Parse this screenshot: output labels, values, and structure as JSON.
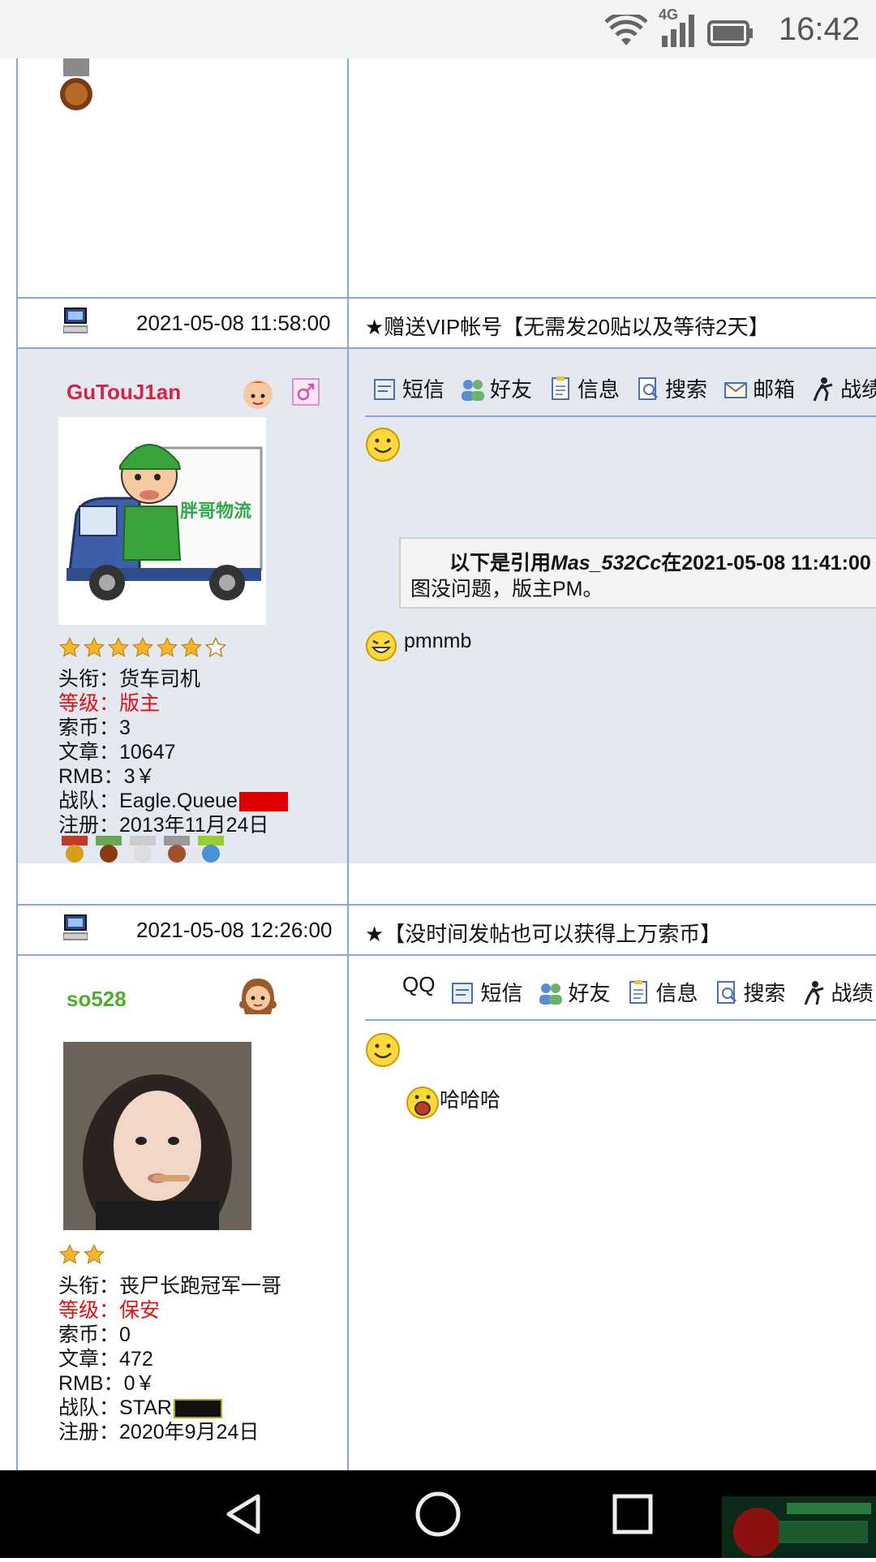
{
  "status_bar": {
    "time": "16:42",
    "network": "4G"
  },
  "post1": {
    "timestamp": "2021-05-08 11:58:00",
    "subject": "★赠送VIP帐号【无需发20贴以及等待2天】",
    "username": "GuTouJ1an",
    "stars": {
      "filled": 6,
      "total": 7
    },
    "info": {
      "title_label": "头衔：",
      "title_value": "货车司机",
      "level_label": "等级：",
      "level_value": "版主",
      "coins_label": "索币：",
      "coins_value": "3",
      "posts_label": "文章：",
      "posts_value": "10647",
      "rmb_label": "RMB：",
      "rmb_value": "3￥",
      "team_label": "战队：",
      "team_value": "Eagle.Queue",
      "reg_label": "注册：",
      "reg_value": "2013年11月24日"
    },
    "avatar_text": "胖哥物流",
    "toolbar": [
      "短信",
      "好友",
      "信息",
      "搜索",
      "邮箱",
      "战绩"
    ],
    "quote_header_prefix": "以下是引用",
    "quote_author": "Mas_532Cc",
    "quote_header_suffix": "在2021-05-08 11:41:00",
    "quote_body": "图没问题，版主PM。",
    "reply_text": "pmnmb"
  },
  "post2": {
    "timestamp": "2021-05-08 12:26:00",
    "subject": "★【没时间发帖也可以获得上万索币】",
    "username": "so528",
    "stars": {
      "filled": 2,
      "total": 2
    },
    "info": {
      "title_label": "头衔：",
      "title_value": "丧尸长跑冠军一哥",
      "level_label": "等级：",
      "level_value": "保安",
      "coins_label": "索币：",
      "coins_value": "0",
      "posts_label": "文章：",
      "posts_value": "472",
      "rmb_label": "RMB：",
      "rmb_value": "0￥",
      "team_label": "战队：",
      "team_value": "STAR",
      "reg_label": "注册：",
      "reg_value": "2020年9月24日"
    },
    "toolbar_prefix": "QQ",
    "toolbar": [
      "短信",
      "好友",
      "信息",
      "搜索",
      "战绩"
    ],
    "reply_text": "哈哈哈"
  },
  "colors": {
    "border": "#8aa6d6",
    "post_bg": "#e4e9f1",
    "username1": "#d2234a",
    "username2": "#4caf2a",
    "level": "#e01010"
  }
}
